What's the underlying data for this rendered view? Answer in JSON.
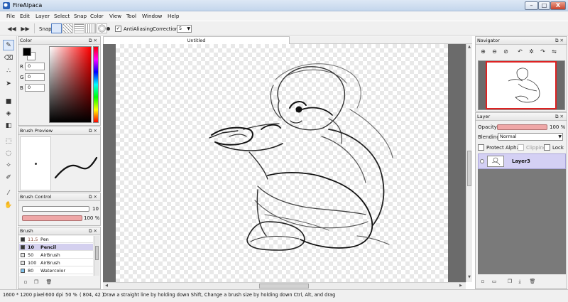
{
  "window": {
    "title": "FireAlpaca",
    "buttons": [
      "–",
      "□",
      "X"
    ]
  },
  "menu": [
    "File",
    "Edit",
    "Layer",
    "Select",
    "Snap",
    "Color",
    "View",
    "Tool",
    "Window",
    "Help"
  ],
  "toolbar": {
    "snap_label": "Snap",
    "antialiasing_label": "AntiAliasing",
    "antialiasing_checked": true,
    "correction_label": "Correction",
    "correction_value": "5"
  },
  "color_panel": {
    "title": "Color",
    "r_label": "R",
    "g_label": "G",
    "b_label": "B",
    "r": "0",
    "g": "0",
    "b": "0",
    "primary_color": "#000000",
    "secondary_color": "#ffffff"
  },
  "brush_preview": {
    "title": "Brush Preview"
  },
  "brush_control": {
    "title": "Brush Control",
    "size_value": "10",
    "opacity_value": "100 %"
  },
  "brush_panel": {
    "title": "Brush",
    "items": [
      {
        "size": "11.5",
        "name": "Pen",
        "selected": false
      },
      {
        "size": "10",
        "name": "Pencil",
        "selected": true
      },
      {
        "size": "50",
        "name": "AirBrush",
        "selected": false
      },
      {
        "size": "100",
        "name": "AirBrush",
        "selected": false
      },
      {
        "size": "80",
        "name": "Watercolor",
        "selected": false
      }
    ]
  },
  "canvas": {
    "tab_title": "Untitled"
  },
  "navigator": {
    "title": "Navigator"
  },
  "layer_panel": {
    "title": "Layer",
    "opacity_label": "Opacity",
    "opacity_value": "100 %",
    "blending_label": "Blending",
    "blending_value": "Normal",
    "protect_alpha_label": "Protect Alpha",
    "clipping_label": "Clipping",
    "lock_label": "Lock",
    "layers": [
      {
        "name": "Layer3",
        "selected": true
      }
    ]
  },
  "status": {
    "size": "1600 * 1200 pixel",
    "dpi": "600 dpi",
    "zoom": "50 %",
    "coords": "( 804, 42 )",
    "hint": "Draw a straight line by holding down Shift, Change a brush size by holding down Ctrl, Alt, and drag"
  }
}
